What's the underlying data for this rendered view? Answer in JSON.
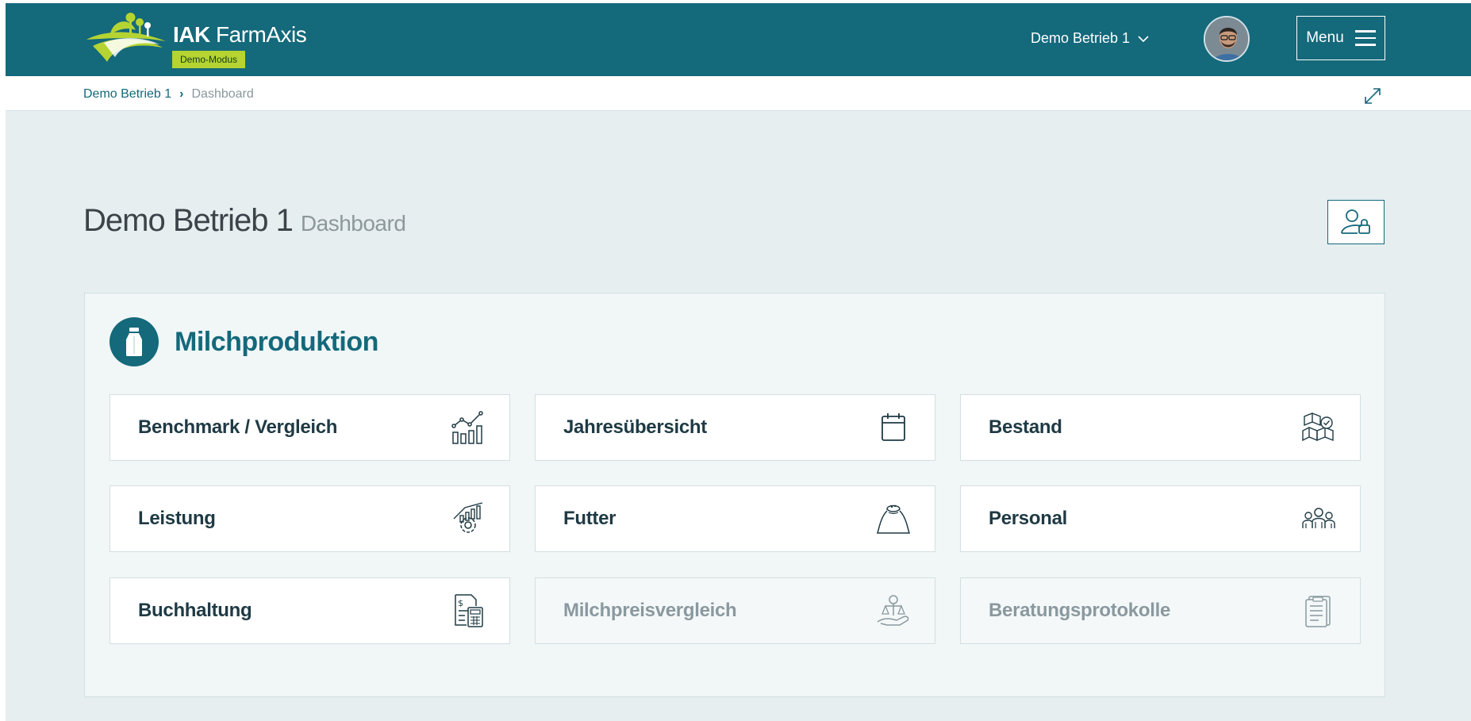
{
  "header": {
    "brand_strong": "IAK",
    "brand_light": "FarmAxis",
    "brand_badge": "Demo-Modus",
    "farm_selector": "Demo Betrieb 1",
    "menu_label": "Menu"
  },
  "breadcrumb": {
    "items": [
      "Demo Betrieb 1",
      "Dashboard"
    ],
    "separator": "›"
  },
  "page": {
    "title": "Demo Betrieb 1",
    "subtitle": "Dashboard"
  },
  "section": {
    "title": "Milchproduktion",
    "icon": "milk-bottle-icon",
    "tiles": [
      {
        "label": "Benchmark / Vergleich",
        "icon": "chart-growth-icon",
        "enabled": true
      },
      {
        "label": "Jahresübersicht",
        "icon": "calendar-icon",
        "enabled": true
      },
      {
        "label": "Bestand",
        "icon": "boxes-stack-icon",
        "enabled": true
      },
      {
        "label": "Leistung",
        "icon": "performance-gear-icon",
        "enabled": true
      },
      {
        "label": "Futter",
        "icon": "feed-sack-icon",
        "enabled": true
      },
      {
        "label": "Personal",
        "icon": "team-icon",
        "enabled": true
      },
      {
        "label": "Buchhaltung",
        "icon": "invoice-calculator-icon",
        "enabled": true
      },
      {
        "label": "Milchpreisvergleich",
        "icon": "price-balance-icon",
        "enabled": false
      },
      {
        "label": "Beratungsprotokolle",
        "icon": "document-list-icon",
        "enabled": false
      }
    ]
  },
  "colors": {
    "primary": "#14697b",
    "accent_badge": "#b5d432",
    "background": "#e6eeef",
    "disabled_text": "#8a999f"
  }
}
